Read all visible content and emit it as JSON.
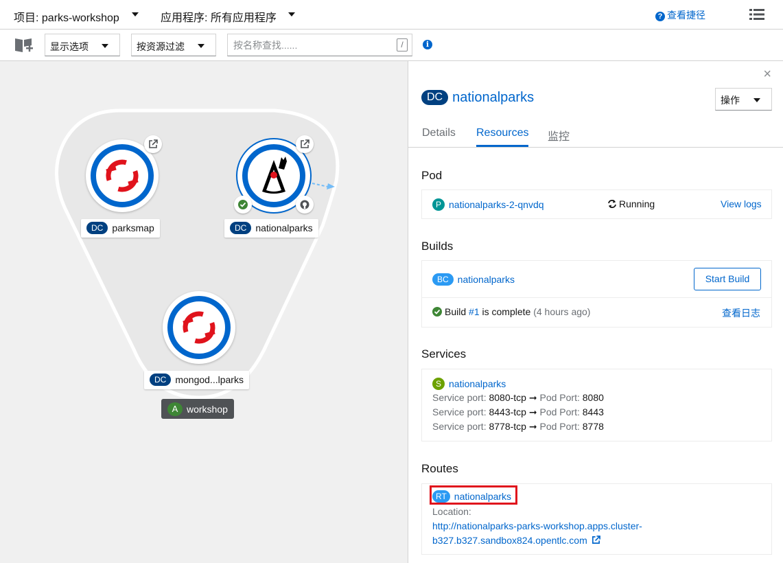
{
  "topbar": {
    "project_selector": "项目: parks-workshop",
    "app_selector": "应用程序: 所有应用程序",
    "quick_start": "查看捷径",
    "quick_icon": "?"
  },
  "toolbar": {
    "display_options": "显示选项",
    "filter_by_resource": "按资源过滤",
    "search_placeholder": "按名称查找......",
    "search_shortcut": "/",
    "info_icon": "i"
  },
  "topology": {
    "nodes": [
      {
        "kind": "DC",
        "name": "parksmap"
      },
      {
        "kind": "DC",
        "name": "nationalparks"
      },
      {
        "kind": "DC",
        "name": "mongod...lparks"
      }
    ],
    "application_group": {
      "kind": "A",
      "name": "workshop"
    }
  },
  "panel": {
    "close": "×",
    "kind": "DC",
    "title": "nationalparks",
    "actions_label": "操作",
    "tabs": [
      "Details",
      "Resources",
      "监控"
    ],
    "active_tab": "Resources",
    "pod": {
      "heading": "Pod",
      "badge": "P",
      "name": "nationalparks-2-qnvdq",
      "status": "Running",
      "view_logs": "View logs"
    },
    "builds": {
      "heading": "Builds",
      "badge": "BC",
      "name": "nationalparks",
      "start_build": "Start Build",
      "build_prefix": "Build",
      "build_number": "#1",
      "build_suffix": "is complete",
      "build_time": "(4 hours ago)",
      "view_log": "查看日志"
    },
    "services": {
      "heading": "Services",
      "badge": "S",
      "name": "nationalparks",
      "ports": [
        {
          "service_label": "Service port:",
          "service_port": "8080-tcp",
          "pod_label": "Pod Port:",
          "pod_port": "8080"
        },
        {
          "service_label": "Service port:",
          "service_port": "8443-tcp",
          "pod_label": "Pod Port:",
          "pod_port": "8443"
        },
        {
          "service_label": "Service port:",
          "service_port": "8778-tcp",
          "pod_label": "Pod Port:",
          "pod_port": "8778"
        }
      ]
    },
    "routes": {
      "heading": "Routes",
      "badge": "RT",
      "name": "nationalparks",
      "location_label": "Location:",
      "url_line1": "http://nationalparks-parks-workshop.apps.cluster-",
      "url_line2": "b327.b327.sandbox824.opentlc.com"
    }
  },
  "colors": {
    "accent": "#0066cc",
    "openshift_red": "#e0131c",
    "success": "#3e8635",
    "dc_badge": "#004080"
  }
}
